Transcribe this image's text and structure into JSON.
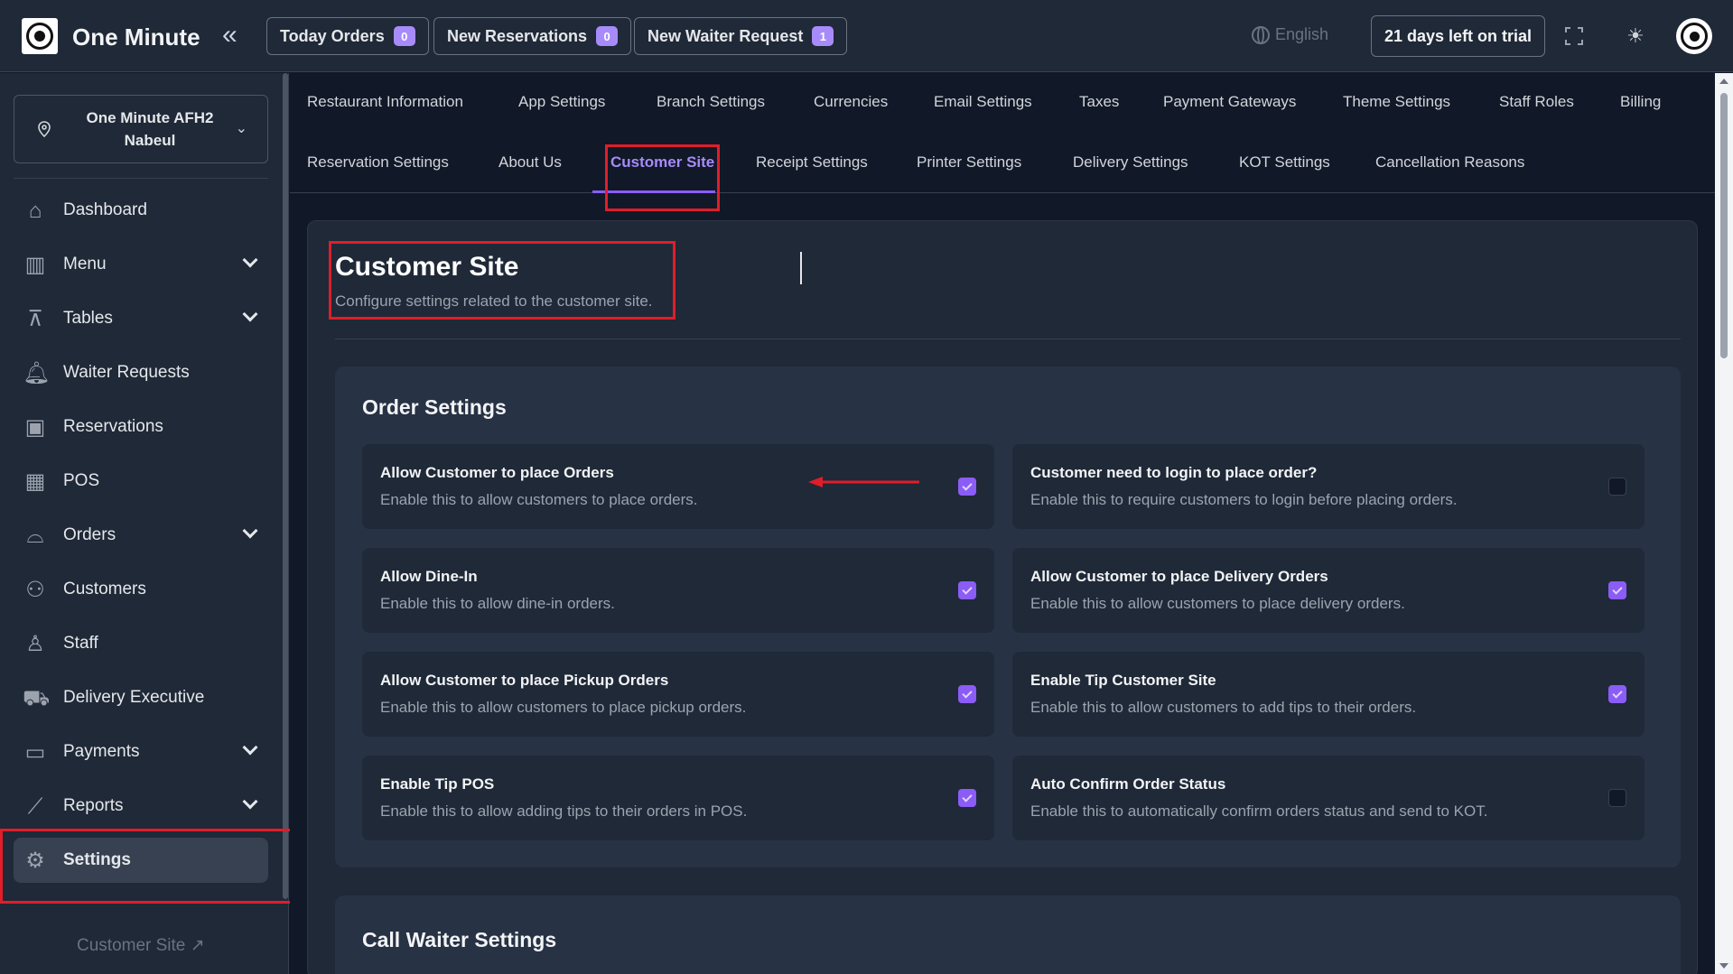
{
  "app": {
    "name": "One Minute"
  },
  "topbar": {
    "buttons": [
      {
        "label": "Today Orders",
        "count": "0"
      },
      {
        "label": "New Reservations",
        "count": "0"
      },
      {
        "label": "New Waiter Request",
        "count": "1"
      }
    ],
    "language": "English",
    "trial": "21 days left on trial"
  },
  "sidebar": {
    "branch": {
      "line1": "One Minute AFH2",
      "line2": "Nabeul"
    },
    "items": [
      {
        "label": "Dashboard",
        "icon": "home-icon",
        "expandable": false
      },
      {
        "label": "Menu",
        "icon": "menu-book-icon",
        "expandable": true
      },
      {
        "label": "Tables",
        "icon": "table-icon",
        "expandable": true
      },
      {
        "label": "Waiter Requests",
        "icon": "bell-icon",
        "expandable": false
      },
      {
        "label": "Reservations",
        "icon": "calendar-icon",
        "expandable": false
      },
      {
        "label": "POS",
        "icon": "pos-icon",
        "expandable": false
      },
      {
        "label": "Orders",
        "icon": "cloche-icon",
        "expandable": true
      },
      {
        "label": "Customers",
        "icon": "users-icon",
        "expandable": false
      },
      {
        "label": "Staff",
        "icon": "staff-icon",
        "expandable": false
      },
      {
        "label": "Delivery Executive",
        "icon": "scooter-icon",
        "expandable": false
      },
      {
        "label": "Payments",
        "icon": "wallet-icon",
        "expandable": true
      },
      {
        "label": "Reports",
        "icon": "chart-icon",
        "expandable": true
      },
      {
        "label": "Settings",
        "icon": "gear-icon",
        "expandable": false,
        "active": true
      }
    ],
    "customer_site_link": "Customer Site"
  },
  "tabs": {
    "row1": [
      "Restaurant Information",
      "App Settings",
      "Branch Settings",
      "Currencies",
      "Email Settings",
      "Taxes",
      "Payment Gateways",
      "Theme Settings",
      "Staff Roles",
      "Billing"
    ],
    "row2": [
      "Reservation Settings",
      "About Us",
      "Customer Site",
      "Receipt Settings",
      "Printer Settings",
      "Delivery Settings",
      "KOT Settings",
      "Cancellation Reasons"
    ],
    "active": "Customer Site"
  },
  "page": {
    "title": "Customer Site",
    "subtitle": "Configure settings related to the customer site."
  },
  "order_settings": {
    "title": "Order Settings",
    "options": [
      {
        "title": "Allow Customer to place Orders",
        "desc": "Enable this to allow customers to place orders.",
        "checked": true
      },
      {
        "title": "Customer need to login to place order?",
        "desc": "Enable this to require customers to login before placing orders.",
        "checked": false
      },
      {
        "title": "Allow Dine-In",
        "desc": "Enable this to allow dine-in orders.",
        "checked": true
      },
      {
        "title": "Allow Customer to place Delivery Orders",
        "desc": "Enable this to allow customers to place delivery orders.",
        "checked": true
      },
      {
        "title": "Allow Customer to place Pickup Orders",
        "desc": "Enable this to allow customers to place pickup orders.",
        "checked": true
      },
      {
        "title": "Enable Tip Customer Site",
        "desc": "Enable this to allow customers to add tips to their orders.",
        "checked": true
      },
      {
        "title": "Enable Tip POS",
        "desc": "Enable this to allow adding tips to their orders in POS.",
        "checked": true
      },
      {
        "title": "Auto Confirm Order Status",
        "desc": "Enable this to automatically confirm orders status and send to KOT.",
        "checked": false
      }
    ]
  },
  "call_waiter": {
    "title": "Call Waiter Settings"
  },
  "colors": {
    "accent": "#8b5cf6",
    "highlight": "#e11d2a",
    "bg": "#111827",
    "surface": "#1f2937"
  }
}
